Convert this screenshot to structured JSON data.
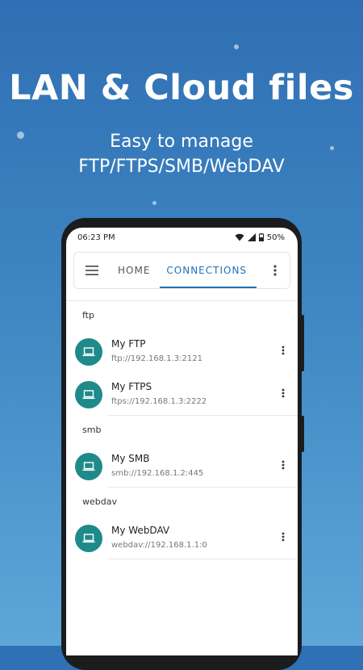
{
  "promo": {
    "headline": "LAN & Cloud files",
    "subline1": "Easy to manage",
    "subline2": "FTP/FTPS/SMB/WebDAV"
  },
  "status_bar": {
    "time": "06:23 PM",
    "battery": "50%",
    "icons": [
      "wifi-icon",
      "signal-icon",
      "battery-icon"
    ]
  },
  "app_bar": {
    "menu_icon": "hamburger-menu-icon",
    "tabs": [
      {
        "label": "HOME",
        "active": false
      },
      {
        "label": "CONNECTIONS",
        "active": true
      }
    ],
    "more_icon": "more-vert-icon"
  },
  "sections": [
    {
      "title": "ftp",
      "items": [
        {
          "name": "My FTP",
          "url": "ftp://192.168.1.3:2121"
        },
        {
          "name": "My FTPS",
          "url": "ftps://192.168.1.3:2222"
        }
      ]
    },
    {
      "title": "smb",
      "items": [
        {
          "name": "My SMB",
          "url": "smb://192.168.1.2:445"
        }
      ]
    },
    {
      "title": "webdav",
      "items": [
        {
          "name": "My WebDAV",
          "url": "webdav://192.168.1.1:0"
        }
      ]
    }
  ],
  "colors": {
    "accent": "#1e72b8",
    "avatar": "#1e8a8a",
    "background": "#3e85c2"
  }
}
